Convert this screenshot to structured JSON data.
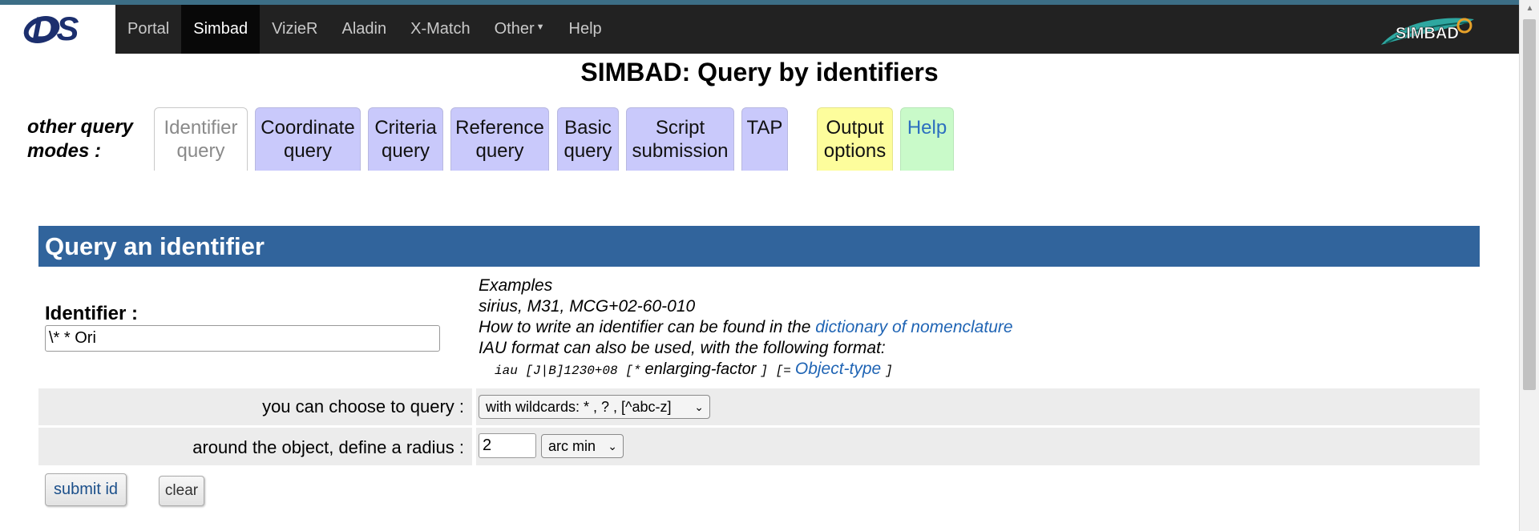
{
  "nav": {
    "items": [
      {
        "label": "Portal"
      },
      {
        "label": "Simbad"
      },
      {
        "label": "VizieR"
      },
      {
        "label": "Aladin"
      },
      {
        "label": "X-Match"
      },
      {
        "label": "Other"
      },
      {
        "label": "Help"
      }
    ],
    "active_index": 1,
    "cds_logo_text": "CDS",
    "simbad_logo_text": "SIMBAD"
  },
  "title": "SIMBAD: Query by identifiers",
  "modes": {
    "label": "other query modes :",
    "tabs": [
      {
        "line1": "Identifier",
        "line2": "query"
      },
      {
        "line1": "Coordinate",
        "line2": "query"
      },
      {
        "line1": "Criteria",
        "line2": "query"
      },
      {
        "line1": "Reference",
        "line2": "query"
      },
      {
        "line1": "Basic",
        "line2": "query"
      },
      {
        "line1": "Script",
        "line2": "submission"
      },
      {
        "line1": "TAP",
        "line2": ""
      },
      {
        "line1": "Output",
        "line2": "options"
      },
      {
        "line1": "Help",
        "line2": ""
      }
    ]
  },
  "panel": {
    "header": "Query an identifier",
    "identifier_label": "Identifier :",
    "identifier_value": "\\* * Ori",
    "examples": {
      "heading": "Examples",
      "line1": "sirius, M31, MCG+02-60-010",
      "line2_prefix": "How to write an identifier can be found in the ",
      "line2_link": "dictionary of nomenclature",
      "line3": "IAU format can also be used, with the following format:",
      "iau_format": "iau [J|B]1230+08 [*",
      "iau_factor": "enlarging-factor",
      "iau_mid": "] [=",
      "iau_link": "Object-type",
      "iau_end": "]"
    },
    "query_mode_label": "you can choose to query :",
    "query_mode_value": "with wildcards: * , ? , [^abc-z]",
    "radius_label": "around the object, define a radius :",
    "radius_value": "2",
    "radius_unit": "arc min",
    "submit_label": "submit id",
    "clear_label": "clear"
  },
  "colors": {
    "navbar": "#222222",
    "panel_header": "#31649c",
    "tab_lavender": "#c9c9fb",
    "tab_yellow": "#fdfd9c",
    "tab_green": "#c9fac9",
    "link": "#1f64b4"
  }
}
